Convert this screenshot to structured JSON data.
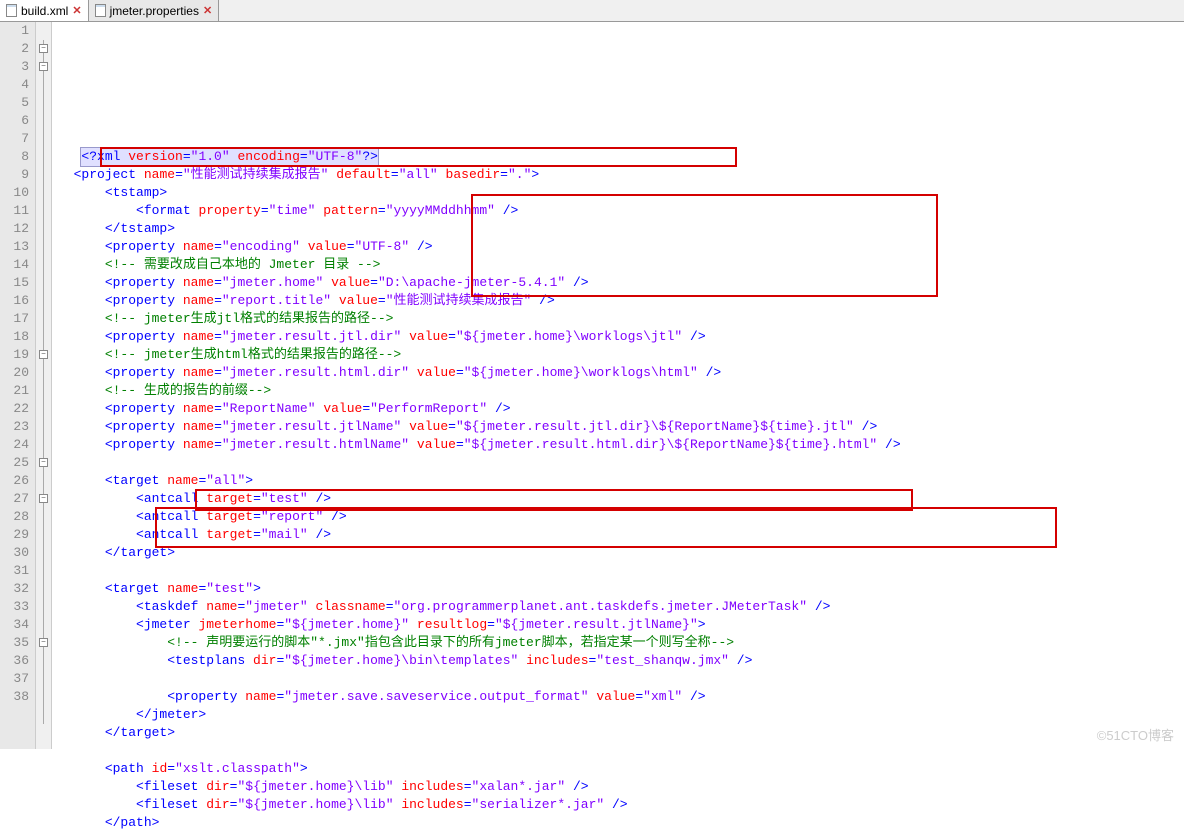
{
  "tabs": {
    "active": "build.xml",
    "inactive": "jmeter.properties"
  },
  "lineStart": 1,
  "lineEnd": 38,
  "code": {
    "l1": {
      "pre": "   ",
      "decl_open": "<?",
      "decl_name": "xml",
      "a1": "version",
      "v1": "\"1.0\"",
      "a2": "encoding",
      "v2": "\"UTF-8\"",
      "decl_close": "?>"
    },
    "l2": {
      "pre": "  ",
      "t": "project",
      "a1": "name",
      "v1": "\"性能测试持续集成报告\"",
      "a2": "default",
      "v2": "\"all\"",
      "a3": "basedir",
      "v3": "\".\""
    },
    "l3": {
      "pre": "      ",
      "t": "tstamp"
    },
    "l4": {
      "pre": "          ",
      "t": "format",
      "a1": "property",
      "v1": "\"time\"",
      "a2": "pattern",
      "v2": "\"yyyyMMddhhmm\""
    },
    "l5": {
      "pre": "      ",
      "t": "tstamp"
    },
    "l6": {
      "pre": "      ",
      "t": "property",
      "a1": "name",
      "v1": "\"encoding\"",
      "a2": "value",
      "v2": "\"UTF-8\""
    },
    "l7": {
      "pre": "      ",
      "c": "<!-- 需要改成自己本地的 Jmeter 目录 -->"
    },
    "l8": {
      "pre": "      ",
      "t": "property",
      "a1": "name",
      "v1": "\"jmeter.home\"",
      "a2": "value",
      "v2": "\"D:\\apache-jmeter-5.4.1\""
    },
    "l9": {
      "pre": "      ",
      "t": "property",
      "a1": "name",
      "v1": "\"report.title\"",
      "a2": "value",
      "v2": "\"性能测试持续集成报告\""
    },
    "l10": {
      "pre": "      ",
      "c": "<!-- jmeter生成jtl格式的结果报告的路径-->"
    },
    "l11": {
      "pre": "      ",
      "t": "property",
      "a1": "name",
      "v1": "\"jmeter.result.jtl.dir\"",
      "a2": "value",
      "v2": "\"${jmeter.home}\\worklogs\\jtl\""
    },
    "l12": {
      "pre": "      ",
      "c": "<!-- jmeter生成html格式的结果报告的路径-->"
    },
    "l13": {
      "pre": "      ",
      "t": "property",
      "a1": "name",
      "v1": "\"jmeter.result.html.dir\"",
      "a2": "value",
      "v2": "\"${jmeter.home}\\worklogs\\html\""
    },
    "l14": {
      "pre": "      ",
      "c": "<!-- 生成的报告的前缀-->"
    },
    "l15": {
      "pre": "      ",
      "t": "property",
      "a1": "name",
      "v1": "\"ReportName\"",
      "a2": "value",
      "v2": "\"PerformReport\""
    },
    "l16": {
      "pre": "      ",
      "t": "property",
      "a1": "name",
      "v1": "\"jmeter.result.jtlName\"",
      "a2": "value",
      "v2": "\"${jmeter.result.jtl.dir}\\${ReportName}${time}.jtl\""
    },
    "l17": {
      "pre": "      ",
      "t": "property",
      "a1": "name",
      "v1": "\"jmeter.result.htmlName\"",
      "a2": "value",
      "v2": "\"${jmeter.result.html.dir}\\${ReportName}${time}.html\""
    },
    "l19": {
      "pre": "      ",
      "t": "target",
      "a1": "name",
      "v1": "\"all\""
    },
    "l20": {
      "pre": "          ",
      "t": "antcall",
      "a1": "target",
      "v1": "\"test\""
    },
    "l21": {
      "pre": "          ",
      "t": "antcall",
      "a1": "target",
      "v1": "\"report\""
    },
    "l22": {
      "pre": "          ",
      "t": "antcall",
      "a1": "target",
      "v1": "\"mail\""
    },
    "l23": {
      "pre": "      ",
      "t": "target"
    },
    "l25": {
      "pre": "      ",
      "t": "target",
      "a1": "name",
      "v1": "\"test\""
    },
    "l26": {
      "pre": "          ",
      "t": "taskdef",
      "a1": "name",
      "v1": "\"jmeter\"",
      "a2": "classname",
      "v2": "\"org.programmerplanet.ant.taskdefs.jmeter.JMeterTask\""
    },
    "l27": {
      "pre": "          ",
      "t": "jmeter",
      "a1": "jmeterhome",
      "v1": "\"${jmeter.home}\"",
      "a2": "resultlog",
      "v2": "\"${jmeter.result.jtlName}\""
    },
    "l28": {
      "pre": "              ",
      "c": "<!-- 声明要运行的脚本\"*.jmx\"指包含此目录下的所有jmeter脚本，若指定某一个则写全称-->"
    },
    "l29": {
      "pre": "              ",
      "t": "testplans",
      "a1": "dir",
      "v1": "\"${jmeter.home}\\bin\\templates\"",
      "a2": "includes",
      "v2": "\"test_shanqw.jmx\""
    },
    "l31": {
      "pre": "              ",
      "t": "property",
      "a1": "name",
      "v1": "\"jmeter.save.saveservice.output_format\"",
      "a2": "value",
      "v2": "\"xml\""
    },
    "l32": {
      "pre": "          ",
      "t": "jmeter"
    },
    "l33": {
      "pre": "      ",
      "t": "target"
    },
    "l35": {
      "pre": "      ",
      "t": "path",
      "a1": "id",
      "v1": "\"xslt.classpath\""
    },
    "l36": {
      "pre": "          ",
      "t": "fileset",
      "a1": "dir",
      "v1": "\"${jmeter.home}\\lib\"",
      "a2": "includes",
      "v2": "\"xalan*.jar\""
    },
    "l37": {
      "pre": "          ",
      "t": "fileset",
      "a1": "dir",
      "v1": "\"${jmeter.home}\\lib\"",
      "a2": "includes",
      "v2": "\"serializer*.jar\""
    },
    "l38": {
      "pre": "      ",
      "t": "path"
    }
  },
  "watermark": "©51CTO博客"
}
